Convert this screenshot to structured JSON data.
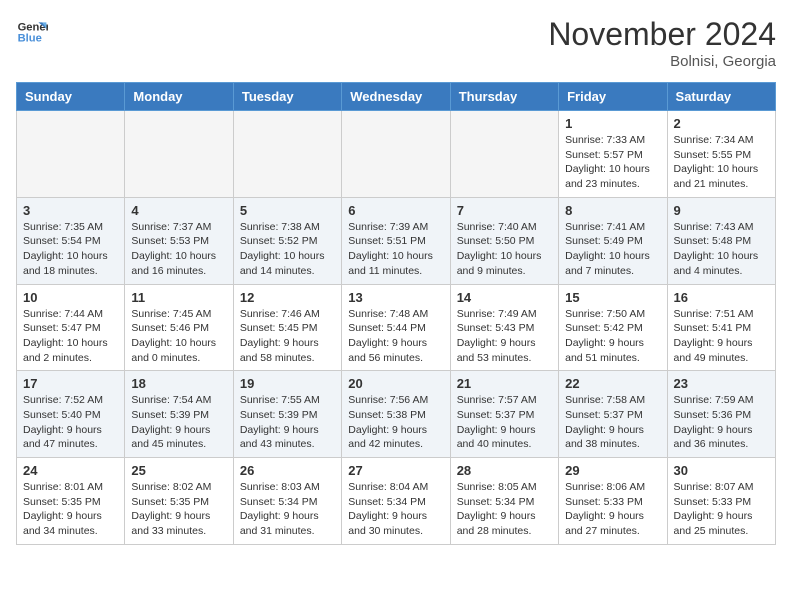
{
  "logo": {
    "line1": "General",
    "line2": "Blue"
  },
  "title": "November 2024",
  "location": "Bolnisi, Georgia",
  "weekdays": [
    "Sunday",
    "Monday",
    "Tuesday",
    "Wednesday",
    "Thursday",
    "Friday",
    "Saturday"
  ],
  "weeks": [
    [
      {
        "day": "",
        "empty": true
      },
      {
        "day": "",
        "empty": true
      },
      {
        "day": "",
        "empty": true
      },
      {
        "day": "",
        "empty": true
      },
      {
        "day": "",
        "empty": true
      },
      {
        "day": "1",
        "info": "Sunrise: 7:33 AM\nSunset: 5:57 PM\nDaylight: 10 hours\nand 23 minutes."
      },
      {
        "day": "2",
        "info": "Sunrise: 7:34 AM\nSunset: 5:55 PM\nDaylight: 10 hours\nand 21 minutes."
      }
    ],
    [
      {
        "day": "3",
        "info": "Sunrise: 7:35 AM\nSunset: 5:54 PM\nDaylight: 10 hours\nand 18 minutes."
      },
      {
        "day": "4",
        "info": "Sunrise: 7:37 AM\nSunset: 5:53 PM\nDaylight: 10 hours\nand 16 minutes."
      },
      {
        "day": "5",
        "info": "Sunrise: 7:38 AM\nSunset: 5:52 PM\nDaylight: 10 hours\nand 14 minutes."
      },
      {
        "day": "6",
        "info": "Sunrise: 7:39 AM\nSunset: 5:51 PM\nDaylight: 10 hours\nand 11 minutes."
      },
      {
        "day": "7",
        "info": "Sunrise: 7:40 AM\nSunset: 5:50 PM\nDaylight: 10 hours\nand 9 minutes."
      },
      {
        "day": "8",
        "info": "Sunrise: 7:41 AM\nSunset: 5:49 PM\nDaylight: 10 hours\nand 7 minutes."
      },
      {
        "day": "9",
        "info": "Sunrise: 7:43 AM\nSunset: 5:48 PM\nDaylight: 10 hours\nand 4 minutes."
      }
    ],
    [
      {
        "day": "10",
        "info": "Sunrise: 7:44 AM\nSunset: 5:47 PM\nDaylight: 10 hours\nand 2 minutes."
      },
      {
        "day": "11",
        "info": "Sunrise: 7:45 AM\nSunset: 5:46 PM\nDaylight: 10 hours\nand 0 minutes."
      },
      {
        "day": "12",
        "info": "Sunrise: 7:46 AM\nSunset: 5:45 PM\nDaylight: 9 hours\nand 58 minutes."
      },
      {
        "day": "13",
        "info": "Sunrise: 7:48 AM\nSunset: 5:44 PM\nDaylight: 9 hours\nand 56 minutes."
      },
      {
        "day": "14",
        "info": "Sunrise: 7:49 AM\nSunset: 5:43 PM\nDaylight: 9 hours\nand 53 minutes."
      },
      {
        "day": "15",
        "info": "Sunrise: 7:50 AM\nSunset: 5:42 PM\nDaylight: 9 hours\nand 51 minutes."
      },
      {
        "day": "16",
        "info": "Sunrise: 7:51 AM\nSunset: 5:41 PM\nDaylight: 9 hours\nand 49 minutes."
      }
    ],
    [
      {
        "day": "17",
        "info": "Sunrise: 7:52 AM\nSunset: 5:40 PM\nDaylight: 9 hours\nand 47 minutes."
      },
      {
        "day": "18",
        "info": "Sunrise: 7:54 AM\nSunset: 5:39 PM\nDaylight: 9 hours\nand 45 minutes."
      },
      {
        "day": "19",
        "info": "Sunrise: 7:55 AM\nSunset: 5:39 PM\nDaylight: 9 hours\nand 43 minutes."
      },
      {
        "day": "20",
        "info": "Sunrise: 7:56 AM\nSunset: 5:38 PM\nDaylight: 9 hours\nand 42 minutes."
      },
      {
        "day": "21",
        "info": "Sunrise: 7:57 AM\nSunset: 5:37 PM\nDaylight: 9 hours\nand 40 minutes."
      },
      {
        "day": "22",
        "info": "Sunrise: 7:58 AM\nSunset: 5:37 PM\nDaylight: 9 hours\nand 38 minutes."
      },
      {
        "day": "23",
        "info": "Sunrise: 7:59 AM\nSunset: 5:36 PM\nDaylight: 9 hours\nand 36 minutes."
      }
    ],
    [
      {
        "day": "24",
        "info": "Sunrise: 8:01 AM\nSunset: 5:35 PM\nDaylight: 9 hours\nand 34 minutes."
      },
      {
        "day": "25",
        "info": "Sunrise: 8:02 AM\nSunset: 5:35 PM\nDaylight: 9 hours\nand 33 minutes."
      },
      {
        "day": "26",
        "info": "Sunrise: 8:03 AM\nSunset: 5:34 PM\nDaylight: 9 hours\nand 31 minutes."
      },
      {
        "day": "27",
        "info": "Sunrise: 8:04 AM\nSunset: 5:34 PM\nDaylight: 9 hours\nand 30 minutes."
      },
      {
        "day": "28",
        "info": "Sunrise: 8:05 AM\nSunset: 5:34 PM\nDaylight: 9 hours\nand 28 minutes."
      },
      {
        "day": "29",
        "info": "Sunrise: 8:06 AM\nSunset: 5:33 PM\nDaylight: 9 hours\nand 27 minutes."
      },
      {
        "day": "30",
        "info": "Sunrise: 8:07 AM\nSunset: 5:33 PM\nDaylight: 9 hours\nand 25 minutes."
      }
    ]
  ]
}
